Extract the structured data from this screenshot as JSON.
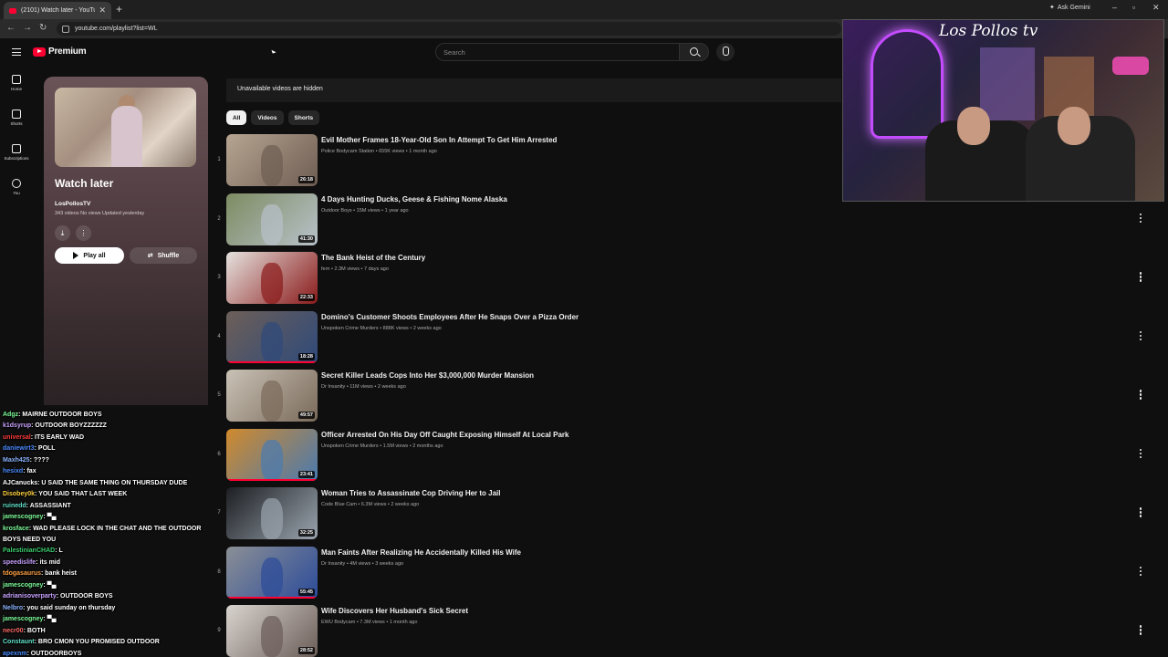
{
  "browser": {
    "tab_title": "(2101) Watch later - YouTube",
    "new_tab": "+",
    "url": "youtube.com/playlist?list=WL",
    "gemini_label": "Ask Gemini",
    "min": "–",
    "max": "▫",
    "close": "✕",
    "back": "←",
    "forward": "→",
    "reload": "↻"
  },
  "masthead": {
    "logo_text": "Premium",
    "search_placeholder": "Search"
  },
  "guide": {
    "items": [
      {
        "label": "Home",
        "icon": "home-icon"
      },
      {
        "label": "Shorts",
        "icon": "shorts-icon"
      },
      {
        "label": "Subscriptions",
        "icon": "subscriptions-icon"
      },
      {
        "label": "You",
        "icon": "you-icon"
      }
    ]
  },
  "playlist": {
    "title": "Watch later",
    "owner": "LosPollosTV",
    "meta": "343 videos  No views  Updated yesterday",
    "download_glyph": "⤓",
    "more_glyph": "⋮",
    "play_all": "Play all",
    "shuffle_glyph": "⇄",
    "shuffle": "Shuffle"
  },
  "notice": "Unavailable videos are hidden",
  "chips": [
    "All",
    "Videos",
    "Shorts"
  ],
  "videos": [
    {
      "index": "1",
      "title": "Evil Mother Frames 18-Year-Old Son In Attempt To Get Him Arrested",
      "channel": "Police Bodycam Station",
      "views": "655K views",
      "age": "1 month ago",
      "duration": "26:18",
      "colors": [
        "#b7a592",
        "#6e5d52"
      ],
      "progress": 0
    },
    {
      "index": "2",
      "title": "4 Days Hunting Ducks, Geese & Fishing Nome Alaska",
      "channel": "Outdoor Boys",
      "views": "15M views",
      "age": "1 year ago",
      "duration": "41:30",
      "colors": [
        "#7d8c62",
        "#b8c1c9"
      ],
      "progress": 0
    },
    {
      "index": "3",
      "title": "The Bank Heist of the Century",
      "channel": "fern",
      "views": "2.3M views",
      "age": "7 days ago",
      "duration": "22:33",
      "colors": [
        "#e5e2de",
        "#8a1a1a"
      ],
      "progress": 0
    },
    {
      "index": "4",
      "title": "Domino's Customer Shoots Employees After He Snaps Over a Pizza Order",
      "channel": "Unspoken Crime Murders",
      "views": "888K views",
      "age": "2 weeks ago",
      "duration": "18:28",
      "colors": [
        "#6d5f58",
        "#2f4a7a"
      ],
      "progress": 1
    },
    {
      "index": "5",
      "title": "Secret Killer Leads Cops Into Her $3,000,000 Murder Mansion",
      "channel": "Dr Insanity",
      "views": "11M views",
      "age": "2 weeks ago",
      "duration": "49:57",
      "colors": [
        "#c9c2b6",
        "#7a6a5a"
      ],
      "progress": 0
    },
    {
      "index": "6",
      "title": "Officer Arrested On His Day Off Caught Exposing Himself At Local Park",
      "channel": "Unspoken Crime Murders",
      "views": "1.5M views",
      "age": "2 months ago",
      "duration": "23:41",
      "colors": [
        "#d18a2c",
        "#4a7ab0"
      ],
      "progress": 1
    },
    {
      "index": "7",
      "title": "Woman Tries to Assassinate Cop Driving Her to Jail",
      "channel": "Code Blue Cam",
      "views": "6.3M views",
      "age": "2 weeks ago",
      "duration": "32:25",
      "colors": [
        "#1c1e22",
        "#9aa4ae"
      ],
      "progress": 0
    },
    {
      "index": "8",
      "title": "Man Faints After Realizing He Accidentally Killed His Wife",
      "channel": "Dr Insanity",
      "views": "4M views",
      "age": "3 weeks ago",
      "duration": "55:45",
      "colors": [
        "#8b8f95",
        "#2c4c9a"
      ],
      "progress": 1
    },
    {
      "index": "9",
      "title": "Wife Discovers Her Husband's Sick Secret",
      "channel": "EWU Bodycam",
      "views": "7.3M views",
      "age": "1 month ago",
      "duration": "28:52",
      "colors": [
        "#d9d4cf",
        "#6b5d58"
      ],
      "progress": 0
    }
  ],
  "webcam": {
    "signature": "Los Pollos tv"
  },
  "chat": [
    {
      "user": "Adgz",
      "text": "MAIRNE OUTDOOR BOYS",
      "color": "#7dfc9a"
    },
    {
      "user": "k1dsyrup",
      "text": "OUTDOOR BOYZZZZZZ",
      "color": "#c8a2ff"
    },
    {
      "user": "universal",
      "text": "ITS EARLY WAD",
      "color": "#ff3b3b"
    },
    {
      "user": "daniewirt3",
      "text": "POLL",
      "color": "#4a8cff"
    },
    {
      "user": "Maxh425",
      "text": "????",
      "color": "#8ab4ff"
    },
    {
      "user": "hesixd",
      "text": "fax",
      "color": "#4a8cff"
    },
    {
      "user": "AJCanucks",
      "text": "U SAID THE SAME THING ON THURSDAY DUDE",
      "color": "#ffffff"
    },
    {
      "user": "Disobey0k",
      "text": "YOU SAID THAT LAST WEEK",
      "color": "#ffd23f"
    },
    {
      "user": "ruinedd",
      "text": "ASSASSIANT",
      "color": "#5fe0c8"
    },
    {
      "user": "jamescogney",
      "text": "▀▄",
      "color": "#7dfc9a"
    },
    {
      "user": "krosface",
      "text": "WAD PLEASE LOCK IN THE CHAT AND THE OUTDOOR BOYS NEED YOU",
      "color": "#7dfc9a"
    },
    {
      "user": "PalestinianCHAD",
      "text": "L",
      "color": "#3ccf6e"
    },
    {
      "user": "speedislife",
      "text": "its mid",
      "color": "#c8a2ff"
    },
    {
      "user": "tdogasaurus",
      "text": "bank heist",
      "color": "#ff9f43"
    },
    {
      "user": "jamescogney",
      "text": "▀▄",
      "color": "#7dfc9a"
    },
    {
      "user": "adrianisoverparty",
      "text": "OUTDOOR BOYS",
      "color": "#c8a2ff"
    },
    {
      "user": "Nelbro",
      "text": "you said sunday on thursday",
      "color": "#8ab4ff"
    },
    {
      "user": "jamescogney",
      "text": "▀▄",
      "color": "#7dfc9a"
    },
    {
      "user": "necr00",
      "text": "BOTH",
      "color": "#ff6b6b"
    },
    {
      "user": "Constaunt",
      "text": "BRO CMON YOU PROMISED OUTDOOR",
      "color": "#5fe0c8"
    },
    {
      "user": "apexnm",
      "text": "OUTDOORBOYS",
      "color": "#4a8cff"
    }
  ]
}
